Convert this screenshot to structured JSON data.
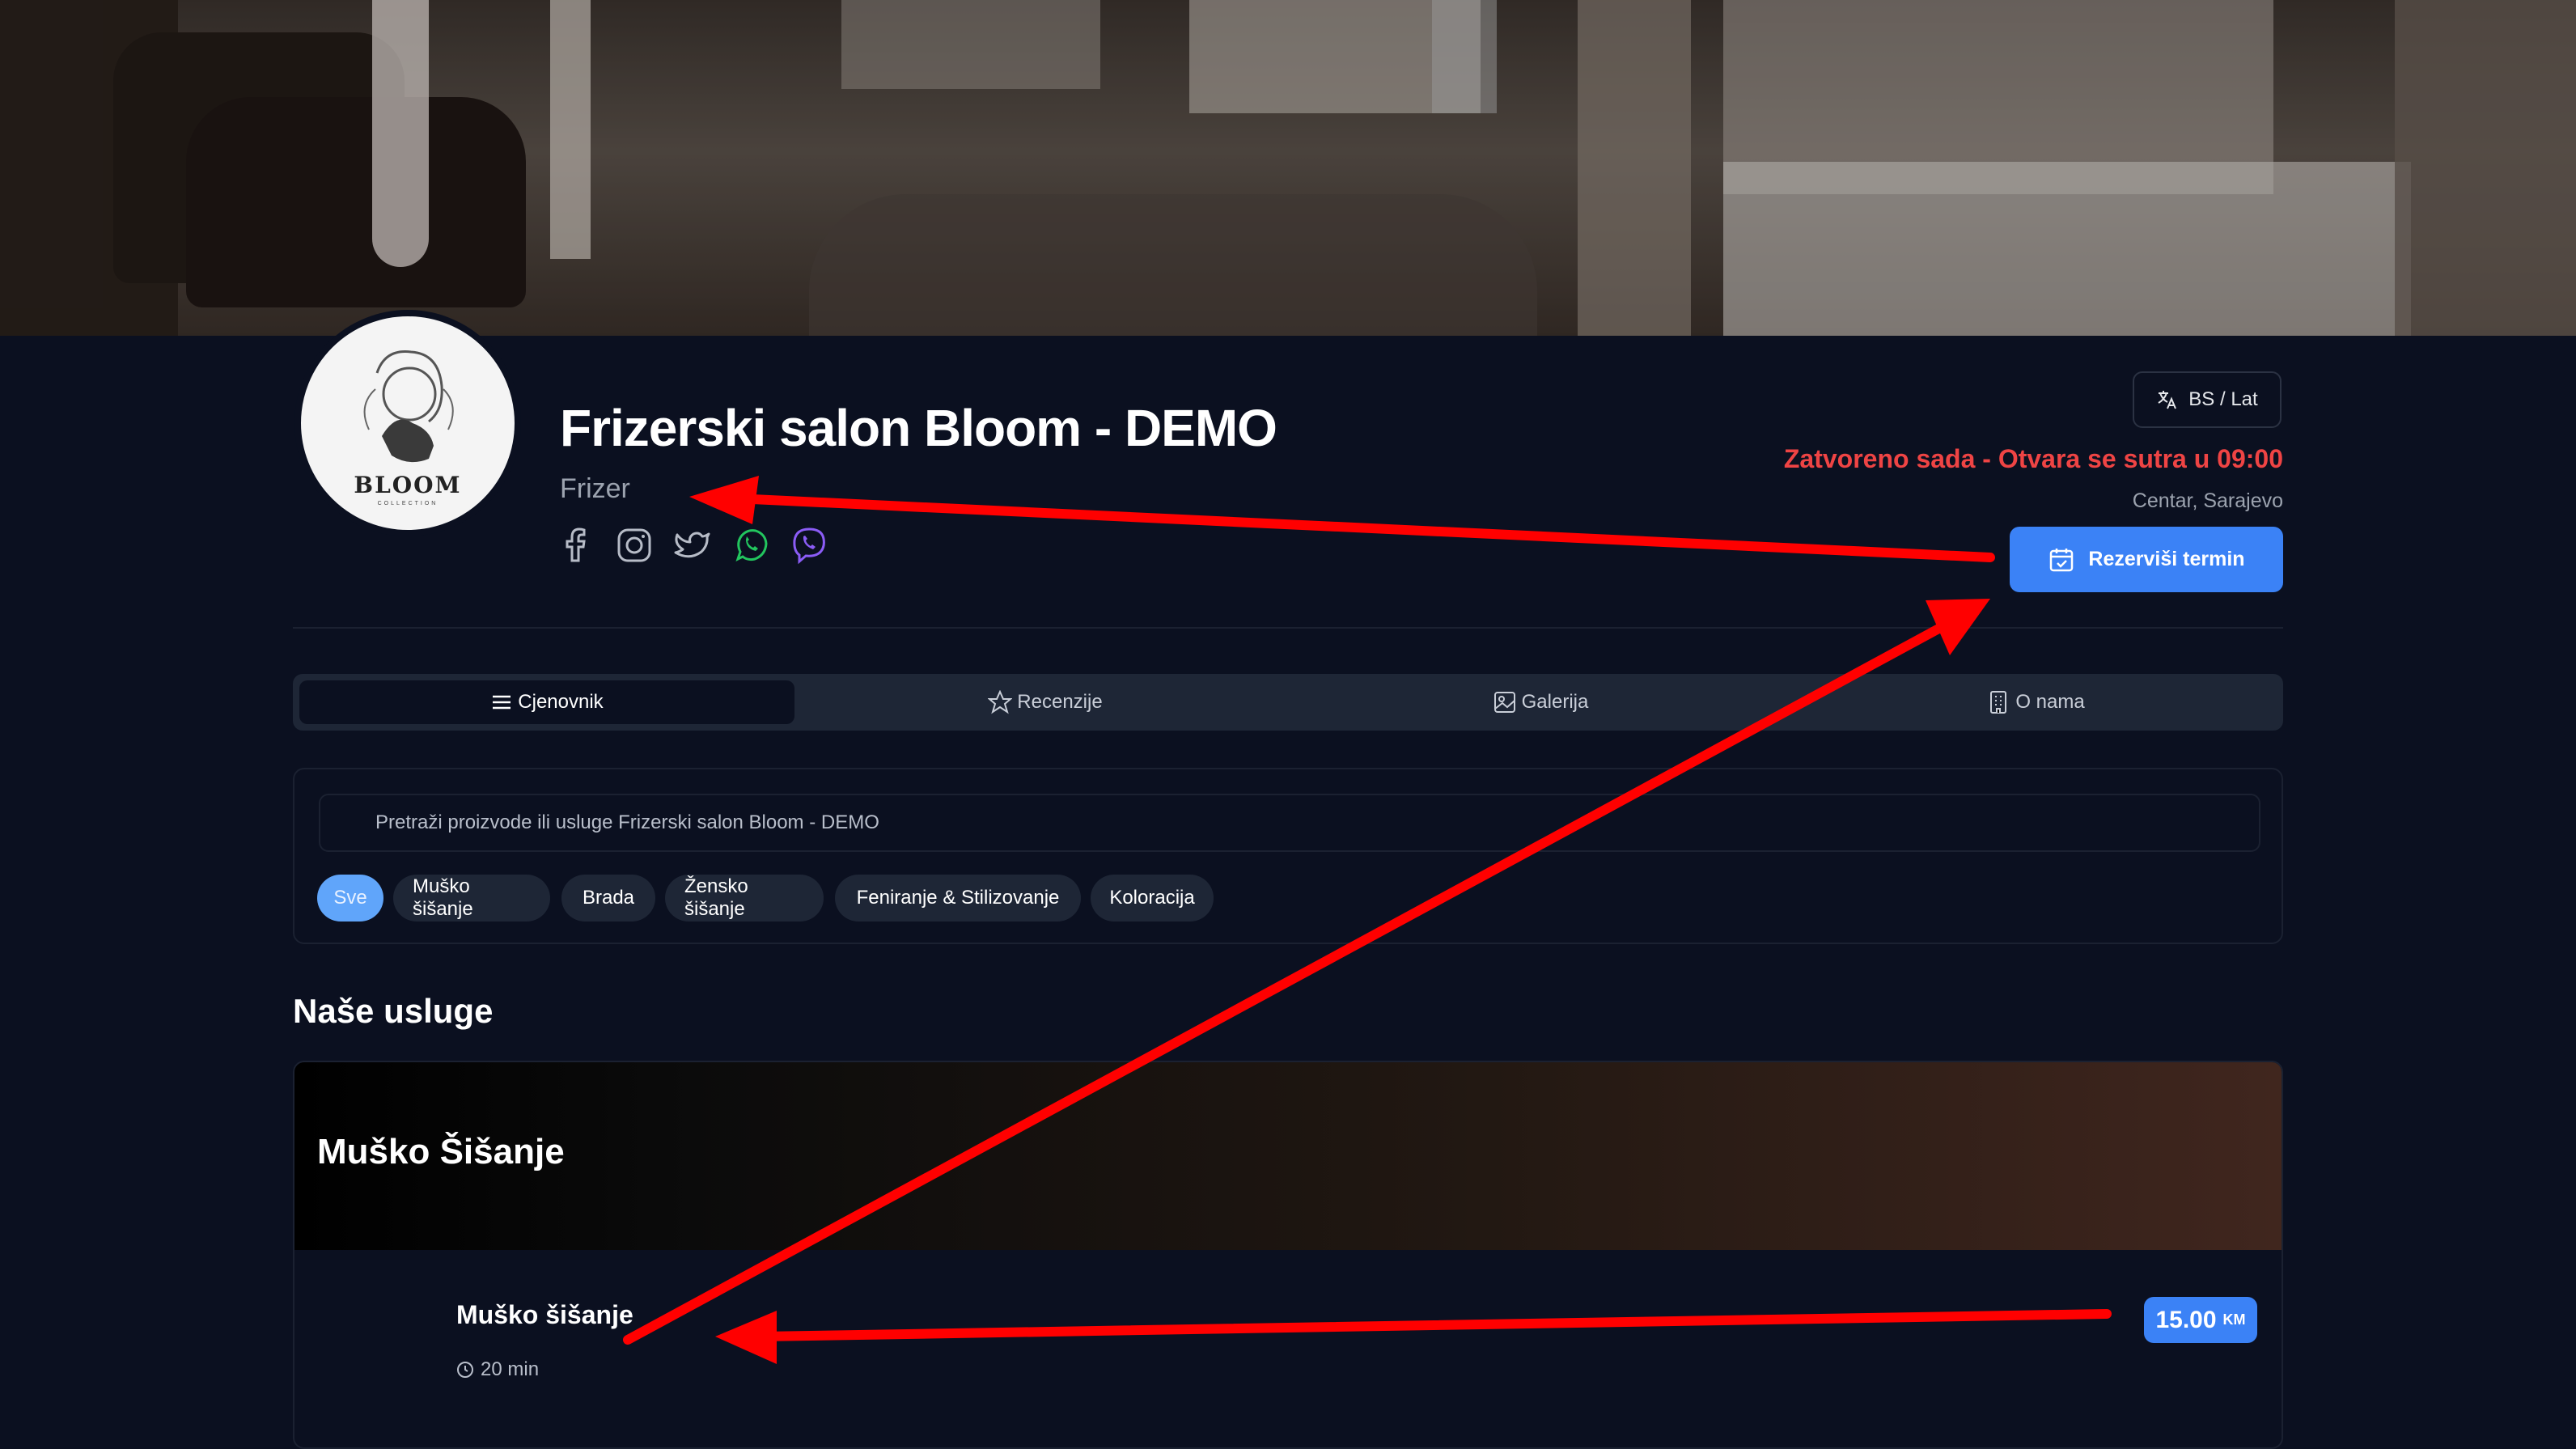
{
  "salon": {
    "logo_text": "BLOOM",
    "logo_sub": "COLLECTION",
    "title": "Frizerski salon Bloom - DEMO",
    "category": "Frizer",
    "socials": [
      "facebook-icon",
      "instagram-icon",
      "twitter-icon",
      "whatsapp-icon",
      "viber-icon"
    ]
  },
  "header": {
    "language": "BS / Lat",
    "status": "Zatvoreno sada - Otvara se sutra u 09:00",
    "location": "Centar, Sarajevo",
    "book_button": "Rezerviši termin"
  },
  "tabs": [
    {
      "label": "Cjenovnik",
      "icon": "menu-icon",
      "active": true
    },
    {
      "label": "Recenzije",
      "icon": "star-icon",
      "active": false
    },
    {
      "label": "Galerija",
      "icon": "image-icon",
      "active": false
    },
    {
      "label": "O nama",
      "icon": "building-icon",
      "active": false
    }
  ],
  "search": {
    "placeholder": "Pretraži proizvode ili usluge Frizerski salon Bloom - DEMO"
  },
  "filters": [
    "Sve",
    "Muško šišanje",
    "Brada",
    "Žensko šišanje",
    "Feniranje & Stilizovanje",
    "Koloracija"
  ],
  "services": {
    "section_title": "Naše usluge",
    "category_title": "Muško Šišanje",
    "item": {
      "name": "Muško šišanje",
      "duration": "20 min",
      "price": "15.00",
      "currency": "KM"
    }
  },
  "colors": {
    "background": "#0b1020",
    "accent": "#3b82f6",
    "status": "#ef4444",
    "arrow": "#ff0000"
  }
}
